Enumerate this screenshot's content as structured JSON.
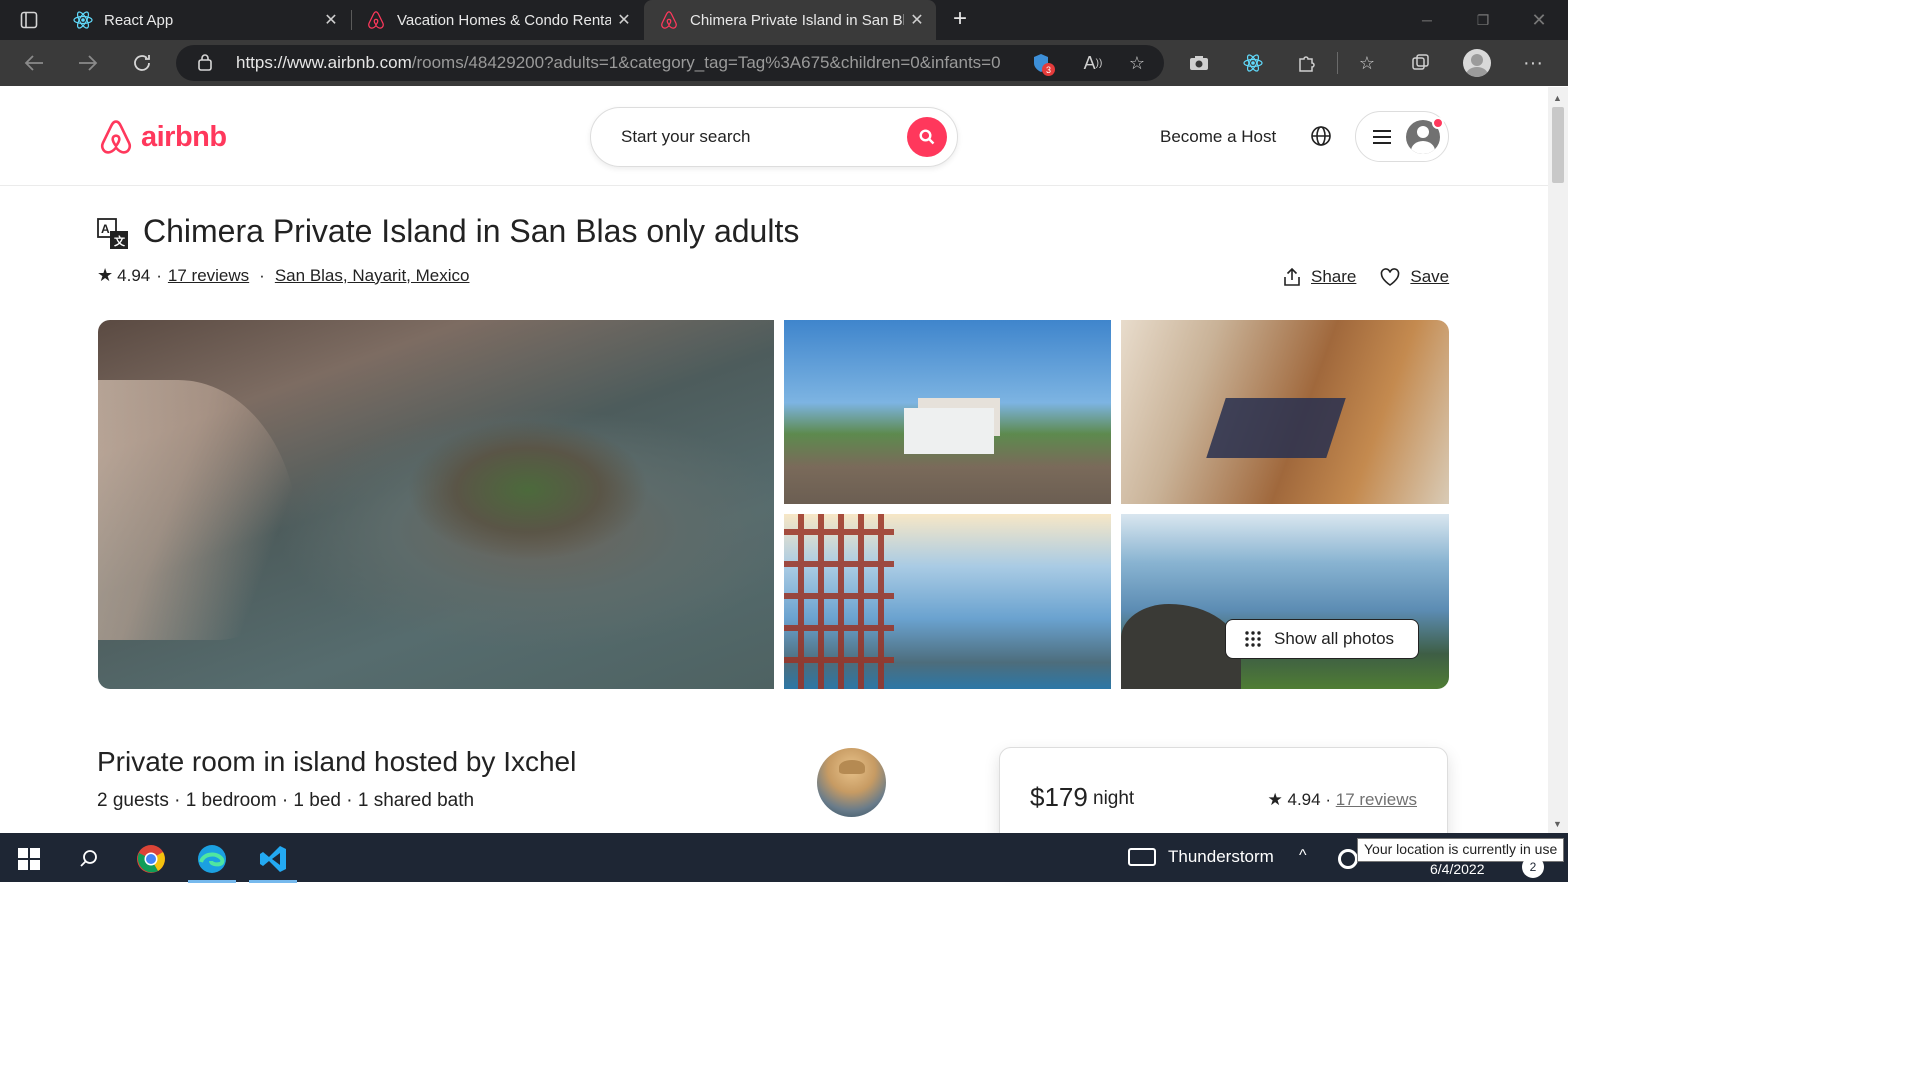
{
  "browser": {
    "tabs": [
      {
        "title": "React App",
        "icon": "react-icon",
        "active": false
      },
      {
        "title": "Vacation Homes & Condo Rentals",
        "icon": "airbnb-icon",
        "active": false
      },
      {
        "title": "Chimera Private Island in San Blas",
        "icon": "airbnb-icon",
        "active": true
      }
    ],
    "url_host": "https://www.airbnb.com",
    "url_path": "/rooms/48429200?adults=1&category_tag=Tag%3A675&children=0&infants=0",
    "extension_badge": "3"
  },
  "header": {
    "logo_text": "airbnb",
    "search_placeholder": "Start your search",
    "become_host": "Become a Host"
  },
  "listing": {
    "title": "Chimera Private Island in San Blas only adults",
    "rating": "4.94",
    "reviews": "17 reviews",
    "location": "San Blas, Nayarit, Mexico",
    "share": "Share",
    "save": "Save",
    "show_all_photos": "Show all photos",
    "room_title": "Private room in island hosted by Ixchel",
    "room_details": "2 guests · 1 bedroom · 1 bed · 1 shared bath"
  },
  "booking": {
    "price": "$179",
    "per": "night",
    "rating": "4.94",
    "reviews": "17 reviews"
  },
  "taskbar": {
    "weather": "Thunderstorm",
    "tooltip": "Your location is currently in use",
    "date": "6/4/2022",
    "notifications": "2"
  },
  "colors": {
    "brand": "#ff385c",
    "chrome_dark": "#202124",
    "taskbar": "#1e2634"
  }
}
